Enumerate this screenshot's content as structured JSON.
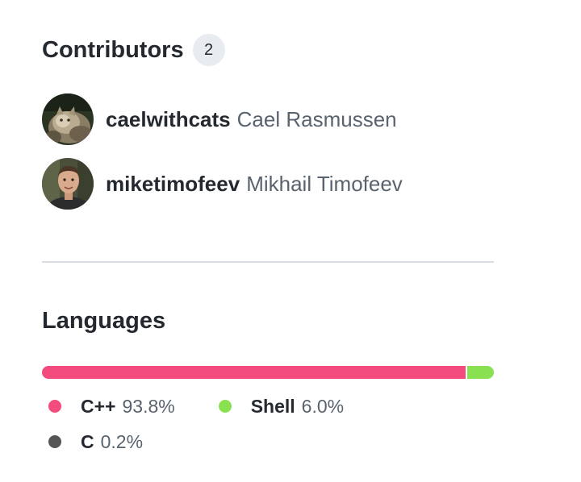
{
  "contributors": {
    "title": "Contributors",
    "count": "2",
    "people": [
      {
        "login": "caelwithcats",
        "name": "Cael Rasmussen",
        "avatar_icon": "cat-photo-avatar"
      },
      {
        "login": "miketimofeev",
        "name": "Mikhail Timofeev",
        "avatar_icon": "person-photo-avatar"
      }
    ]
  },
  "languages": {
    "title": "Languages",
    "items": [
      {
        "name": "C++",
        "percent": "93.8%",
        "value": 93.8,
        "color": "#f34b7d"
      },
      {
        "name": "Shell",
        "percent": "6.0%",
        "value": 6.0,
        "color": "#89e051"
      },
      {
        "name": "C",
        "percent": "0.2%",
        "value": 0.2,
        "color": "#555555"
      }
    ]
  }
}
